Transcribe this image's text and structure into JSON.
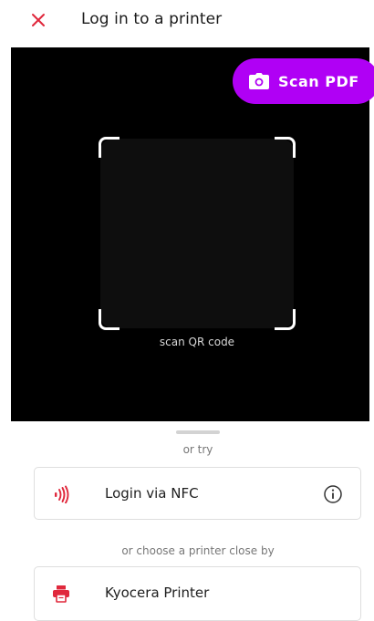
{
  "header": {
    "title": "Log in to a printer",
    "close_icon": "close-icon"
  },
  "camera": {
    "scan_pdf_label": "Scan PDF",
    "scan_pdf_icon": "camera-icon",
    "qr_label": "scan QR code"
  },
  "options": {
    "or_try": "or try",
    "nfc": {
      "label": "Login via NFC",
      "icon": "nfc-icon",
      "info_icon": "info-icon"
    },
    "or_choose": "or choose a printer close by",
    "printer": {
      "label": "Kyocera Printer",
      "icon": "printer-icon"
    }
  },
  "colors": {
    "accent_red": "#e0283c",
    "scan_button": "#b000f5",
    "camera_bg": "#000000"
  }
}
